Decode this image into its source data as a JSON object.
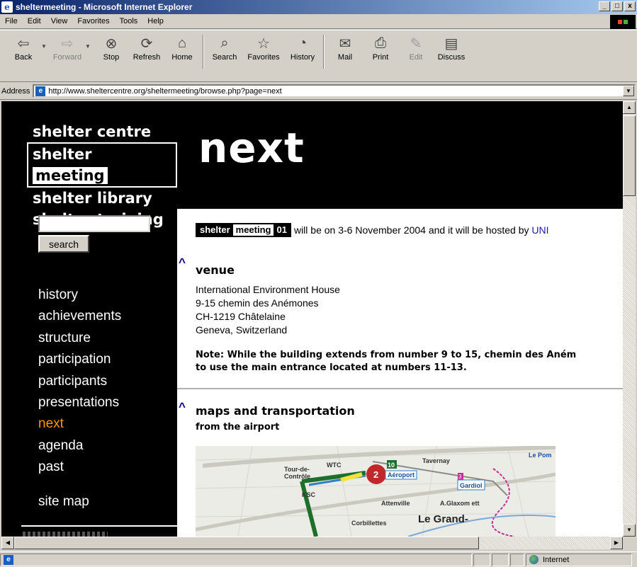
{
  "window": {
    "title": "sheltermeeting - Microsoft Internet Explorer",
    "buttons": {
      "minimize": "_",
      "maximize": "□",
      "close": "x"
    }
  },
  "menu": {
    "items": [
      {
        "label": "File"
      },
      {
        "label": "Edit"
      },
      {
        "label": "View"
      },
      {
        "label": "Favorites"
      },
      {
        "label": "Tools"
      },
      {
        "label": "Help"
      }
    ]
  },
  "toolbar": {
    "back": "Back",
    "forward": "Forward",
    "stop": "Stop",
    "refresh": "Refresh",
    "home": "Home",
    "search": "Search",
    "favorites": "Favorites",
    "history": "History",
    "mail": "Mail",
    "print": "Print",
    "edit": "Edit",
    "discuss": "Discuss"
  },
  "address": {
    "label": "Address",
    "url": "http://www.sheltercentre.org/sheltermeeting/browse.php?page=next"
  },
  "sidebar": {
    "brand": {
      "line1": "shelter centre",
      "line2a": "shelter",
      "line2b": "meeting",
      "line3": "shelter library",
      "line4": "shelter training"
    },
    "search_button": "search",
    "nav": [
      "history",
      "achievements",
      "structure",
      "participation",
      "participants",
      "presentations",
      "next",
      "agenda",
      "past"
    ],
    "active": "next",
    "site_map": "site map"
  },
  "page": {
    "heading": "next",
    "badge": {
      "w1": "shelter",
      "w2": "meeting",
      "w3": "01"
    },
    "intro_text": "will be on 3-6 November 2004 and it will be hosted by",
    "intro_link": "UNI",
    "venue": {
      "arrow": "^",
      "title": "venue",
      "lines": [
        "International Environment House",
        "9-15 chemin des Anémones",
        "CH-1219 Châtelaine",
        "Geneva, Switzerland"
      ],
      "note_line1": "Note: While the building extends from number 9 to 15, chemin des Aném",
      "note_line2": "to use the main entrance located at numbers 11-13."
    },
    "maps": {
      "arrow": "^",
      "title": "maps and transportation",
      "subheading": "from the airport"
    },
    "map_labels": {
      "tour": "Tour-de-",
      "controle": "Contrôle",
      "wtc": "WTC",
      "tavernay": "Tavernay",
      "aeroport": "Aéroport",
      "gardiol": "Gardiol",
      "le_pom": "Le Pom",
      "ksc": "KSC",
      "attenville": "Attenville",
      "glaxo": "A.Glaxom ett",
      "corbillettes": "Corbillettes",
      "le_grand": "Le Grand-",
      "num2": "2",
      "num10": "10",
      "num3": "3"
    }
  },
  "status": {
    "zone": "Internet"
  }
}
